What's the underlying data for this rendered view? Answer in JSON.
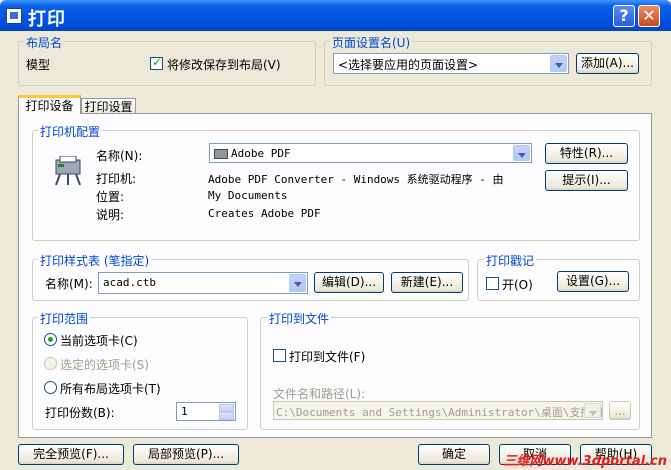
{
  "window": {
    "title": "打印"
  },
  "layout_group": {
    "legend": "布局名",
    "layout_name": "模型",
    "save_changes_label": "将修改保存到布局(V)",
    "save_changes_checked": true
  },
  "page_setup_group": {
    "legend": "页面设置名(U)",
    "selected": "<选择要应用的页面设置>",
    "add_button": "添加(A)..."
  },
  "tabs": [
    {
      "label": "打印设备",
      "active": true
    },
    {
      "label": "打印设置",
      "active": false
    }
  ],
  "printer_group": {
    "legend": "打印机配置",
    "name_label": "名称(N):",
    "name_value": "Adobe PDF",
    "properties_button": "特性(R)...",
    "hints_button": "提示(I)...",
    "rows": [
      {
        "label": "打印机:",
        "value": "Adobe PDF Converter - Windows 系统驱动程序 - 由"
      },
      {
        "label": "位置:",
        "value": "My Documents"
      },
      {
        "label": "说明:",
        "value": "Creates Adobe PDF"
      }
    ]
  },
  "plot_style_group": {
    "legend": "打印样式表 (笔指定)",
    "name_label": "名称(M):",
    "value": "acad.ctb",
    "edit_button": "编辑(D)...",
    "new_button": "新建(E)..."
  },
  "plot_stamp_group": {
    "legend": "打印戳记",
    "on_label": "开(O)",
    "on_checked": false,
    "settings_button": "设置(G)..."
  },
  "plot_range_group": {
    "legend": "打印范围",
    "options": [
      {
        "label": "当前选项卡(C)",
        "checked": true,
        "disabled": false
      },
      {
        "label": "选定的选项卡(S)",
        "checked": false,
        "disabled": true
      },
      {
        "label": "所有布局选项卡(T)",
        "checked": false,
        "disabled": false
      }
    ],
    "copies_label": "打印份数(B):",
    "copies_value": "1"
  },
  "plot_to_file_group": {
    "legend": "打印到文件",
    "plot_to_file_label": "打印到文件(F)",
    "plot_to_file_checked": false,
    "path_label": "文件名和路径(L):",
    "path_value": "C:\\Documents and Settings\\Administrator\\桌面\\支撑钢",
    "browse_button": "..."
  },
  "bottom_buttons": {
    "full_preview": "完全预览(F)...",
    "partial_preview": "局部预览(P)...",
    "ok": "确定",
    "cancel": "取消",
    "help": "帮助(H)"
  },
  "watermark": "三维网www.3dportal.cn",
  "colors": {
    "titlebar": "#0054e3",
    "legend": "#0046d5",
    "dialog_bg": "#ece9d8",
    "check_mark": "#21a121"
  }
}
